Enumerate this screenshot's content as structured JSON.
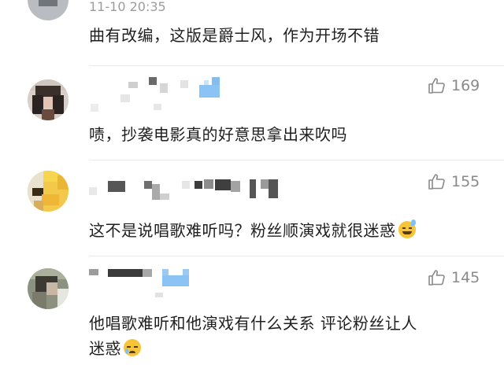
{
  "comments": [
    {
      "time": "11-10 20:35",
      "text": "曲有改编，这版是爵士风，作为开场不错"
    },
    {
      "likes": "169",
      "text": "啧，抄袭电影真的好意思拿出来吹吗"
    },
    {
      "likes": "155",
      "text": "这不是说唱歌难听吗？粉丝顺演戏就很迷惑"
    },
    {
      "likes": "145",
      "text_line1": "他唱歌难听和他演戏有什么关系 评论粉丝让人",
      "text_line2": "迷惑"
    }
  ],
  "icons": {
    "like": "thumbs-up-icon",
    "emoji_sweat": "sweat-smile-emoji",
    "emoji_cry": "sad-tear-emoji"
  },
  "colors": {
    "text": "#1f1f1f",
    "meta": "#9b9b9b",
    "emoji": "#f6c437",
    "vip_badge": "#8cc3f5"
  }
}
